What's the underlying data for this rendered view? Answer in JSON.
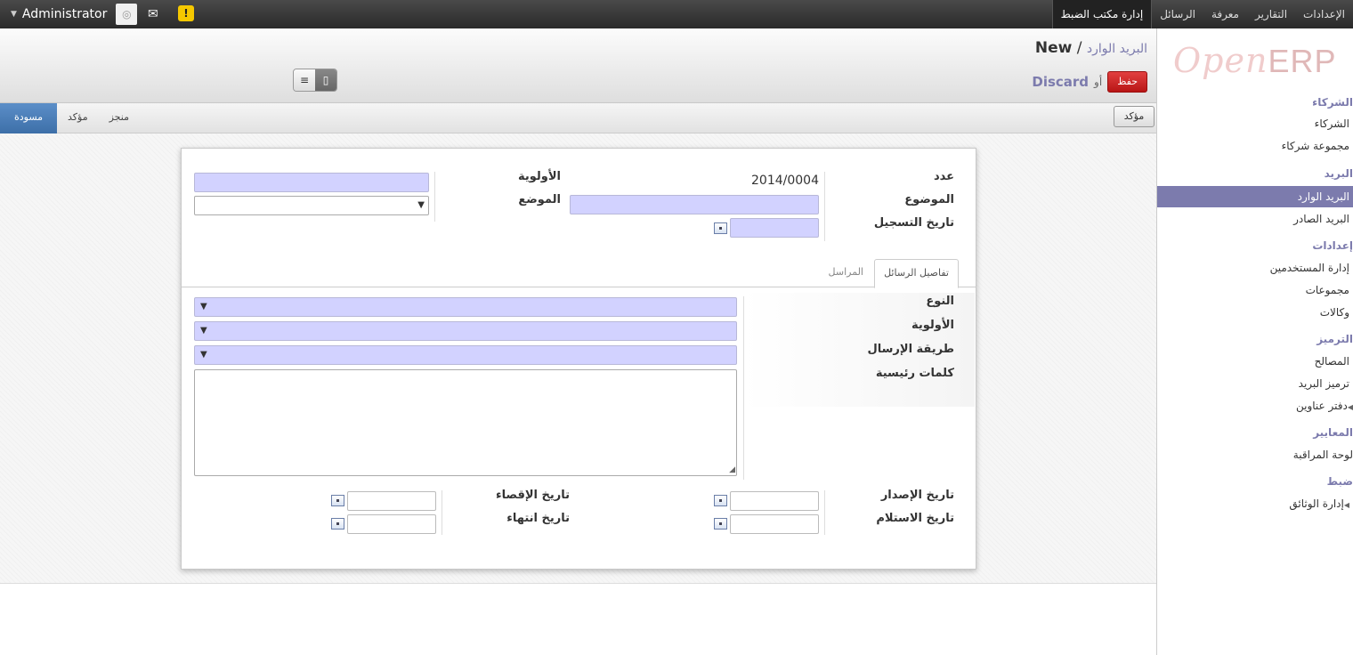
{
  "topbar": {
    "user_name": "Administrator",
    "menu": [
      "الإعدادات",
      "التقارير",
      "معرفة",
      "الرسائل",
      "إدارة مكتب الضبط"
    ],
    "active_menu": "إدارة مكتب الضبط"
  },
  "logo": {
    "open": "Open",
    "erp": "ERP"
  },
  "sidebar": {
    "sections": [
      {
        "title": "الشركاء",
        "items": [
          "الشركاء",
          "مجموعة شركاء"
        ]
      },
      {
        "title": "البريد",
        "items": [
          "البريد الوارد",
          "البريد الصادر"
        ]
      },
      {
        "title": "إعدادات",
        "items": [
          "إدارة المستخدمين",
          "مجموعات",
          "وكالات"
        ]
      },
      {
        "title": "الترميز",
        "items": [
          "المصالح",
          "ترميز البريد",
          "دفتر عناوين"
        ]
      },
      {
        "title": "المعايير",
        "items": [
          "لوحة المراقبة"
        ]
      },
      {
        "title": "ضبط",
        "items": [
          "إدارة الوثائق"
        ]
      }
    ],
    "active_item": "البريد الوارد"
  },
  "breadcrumb": {
    "parent": "البريد الوارد",
    "sep": "/",
    "current": "New"
  },
  "actions": {
    "save": "حفظ",
    "or": "أو",
    "discard": "Discard"
  },
  "statusbar": {
    "confirm_button": "مؤكد",
    "stages": [
      "مسودة",
      "مؤكد",
      "منجز"
    ],
    "current_stage": "مسودة"
  },
  "form": {
    "labels": {
      "number": "عدد",
      "subject": "الموضوع",
      "reg_date": "تاريخ التسجيل",
      "priority": "الأولوية",
      "position": "الموضع",
      "type": "النوع",
      "priority2": "الأولوية",
      "send_method": "طريقة الإرسال",
      "keywords": "كلمات رئيسية",
      "issue_date": "تاريخ الإصدار",
      "receive_date": "تاريخ الاستلام",
      "deadline": "تاريخ الإقصاء",
      "end_date": "تاريخ انتهاء"
    },
    "number_value": "2014/0004",
    "tabs": [
      "تفاصيل الرسائل",
      "المراسل"
    ],
    "active_tab": "تفاصيل الرسائل",
    "dropdown_arrow": "▼"
  },
  "colors": {
    "accent": "#7c7bad",
    "required_field": "#d2d2ff",
    "save_button": "#d02a2a",
    "stage_active": "#4a7fbd"
  }
}
